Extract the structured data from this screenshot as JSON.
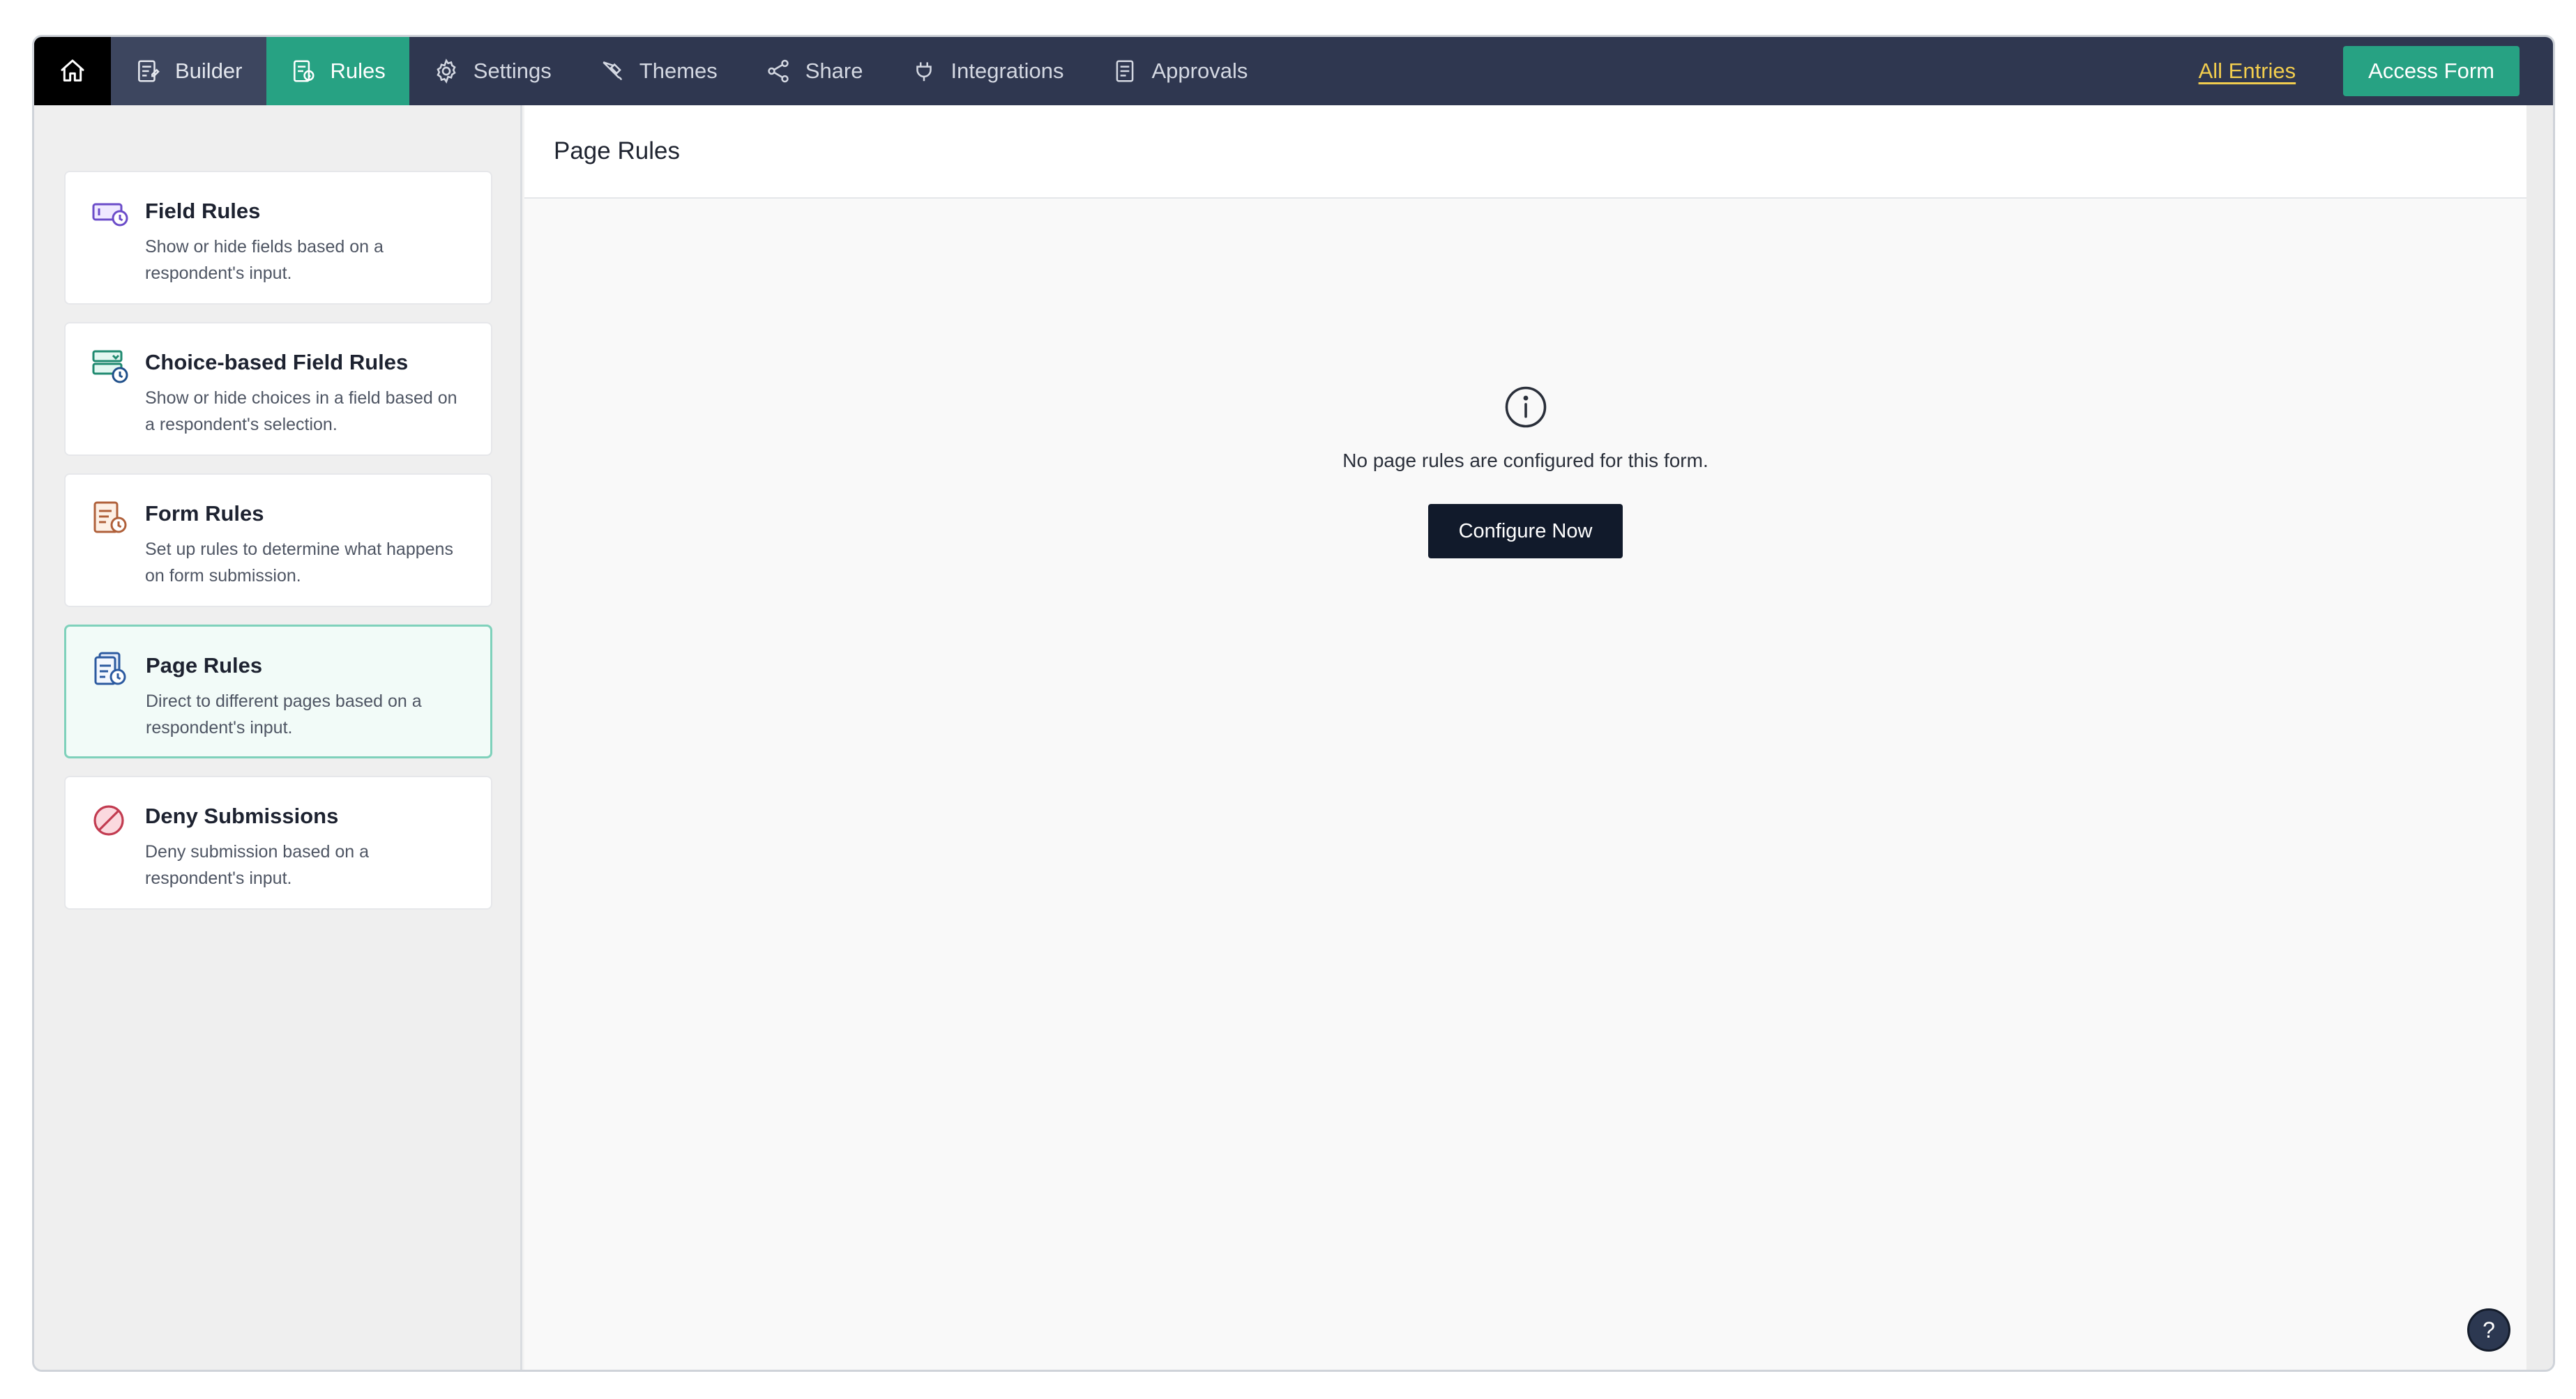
{
  "nav": {
    "items": [
      {
        "label": "Builder",
        "icon": "builder-icon"
      },
      {
        "label": "Rules",
        "icon": "rules-icon"
      },
      {
        "label": "Settings",
        "icon": "gear-icon"
      },
      {
        "label": "Themes",
        "icon": "brush-icon"
      },
      {
        "label": "Share",
        "icon": "share-icon"
      },
      {
        "label": "Integrations",
        "icon": "plug-icon"
      },
      {
        "label": "Approvals",
        "icon": "approvals-icon"
      }
    ],
    "active_item": "Rules",
    "all_entries_label": "All Entries",
    "access_form_label": "Access Form"
  },
  "sidebar": {
    "items": [
      {
        "title": "Field Rules",
        "description": "Show or hide fields based on a respondent's input.",
        "icon": "field-rules-icon"
      },
      {
        "title": "Choice-based Field Rules",
        "description": "Show or hide choices in a field based on a respondent's selection.",
        "icon": "choice-rules-icon"
      },
      {
        "title": "Form Rules",
        "description": "Set up rules to determine what happens on form submission.",
        "icon": "form-rules-icon"
      },
      {
        "title": "Page Rules",
        "description": "Direct to different pages based on a respondent's input.",
        "icon": "page-rules-icon"
      },
      {
        "title": "Deny Submissions",
        "description": "Deny submission based on a respondent's input.",
        "icon": "deny-icon"
      }
    ],
    "active_item": "Page Rules"
  },
  "main": {
    "title": "Page Rules",
    "empty_message": "No page rules are configured for this form.",
    "configure_label": "Configure Now",
    "help_label": "?"
  },
  "colors": {
    "nav_bg": "#2f3750",
    "accent": "#27a283",
    "link": "#f2cd4e",
    "button_dark": "#111a2b"
  }
}
